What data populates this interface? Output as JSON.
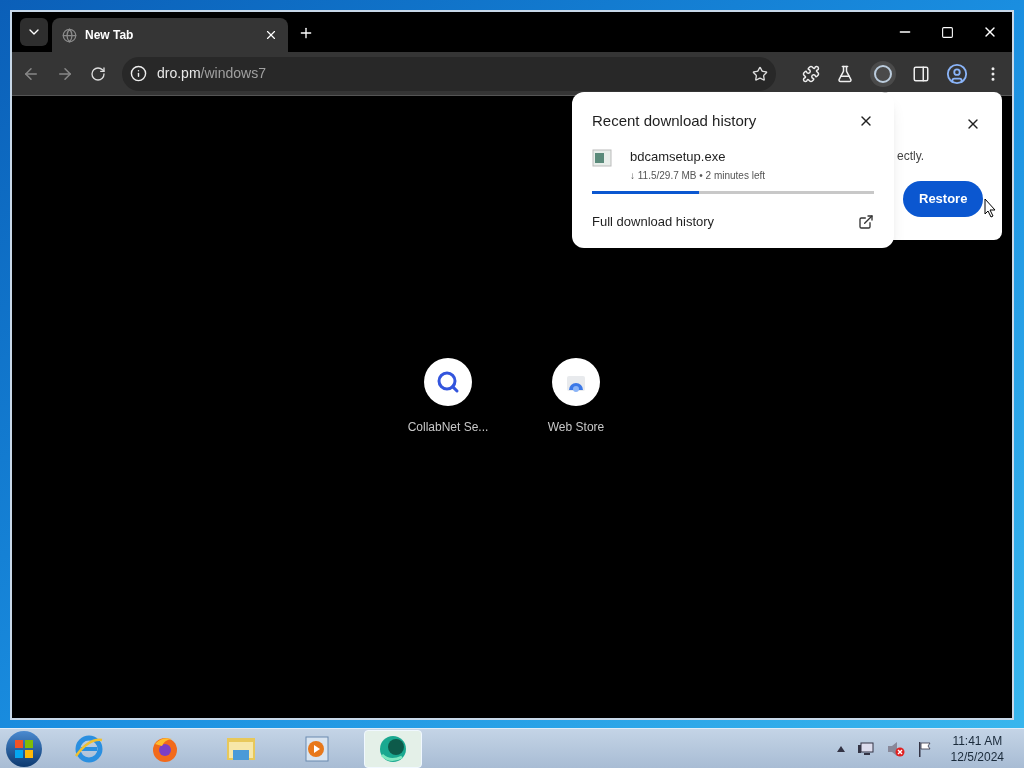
{
  "tabs": [
    {
      "title": "New Tab",
      "selected": true
    }
  ],
  "address": {
    "host": "dro.pm",
    "path": "/windows7"
  },
  "download_bubble": {
    "title": "Recent download history",
    "file": "bdcamsetup.exe",
    "status": "↓ 11.5/29.7 MB • 2 minutes left",
    "level": 0.38,
    "footer": "Full download history"
  },
  "restore_bubble": {
    "text": "ectly.",
    "button": "Restore"
  },
  "shortcuts": [
    {
      "label": "CollabNet Se...",
      "kind": "search"
    },
    {
      "label": "Web Store",
      "kind": "store"
    }
  ],
  "taskbar": {
    "apps": [
      {
        "kind": "ie",
        "selected": false
      },
      {
        "kind": "firefox",
        "selected": false
      },
      {
        "kind": "folder",
        "selected": false
      },
      {
        "kind": "media",
        "selected": false
      },
      {
        "kind": "green",
        "selected": true
      }
    ],
    "time": "11:41 AM",
    "date": "12/5/2024"
  }
}
